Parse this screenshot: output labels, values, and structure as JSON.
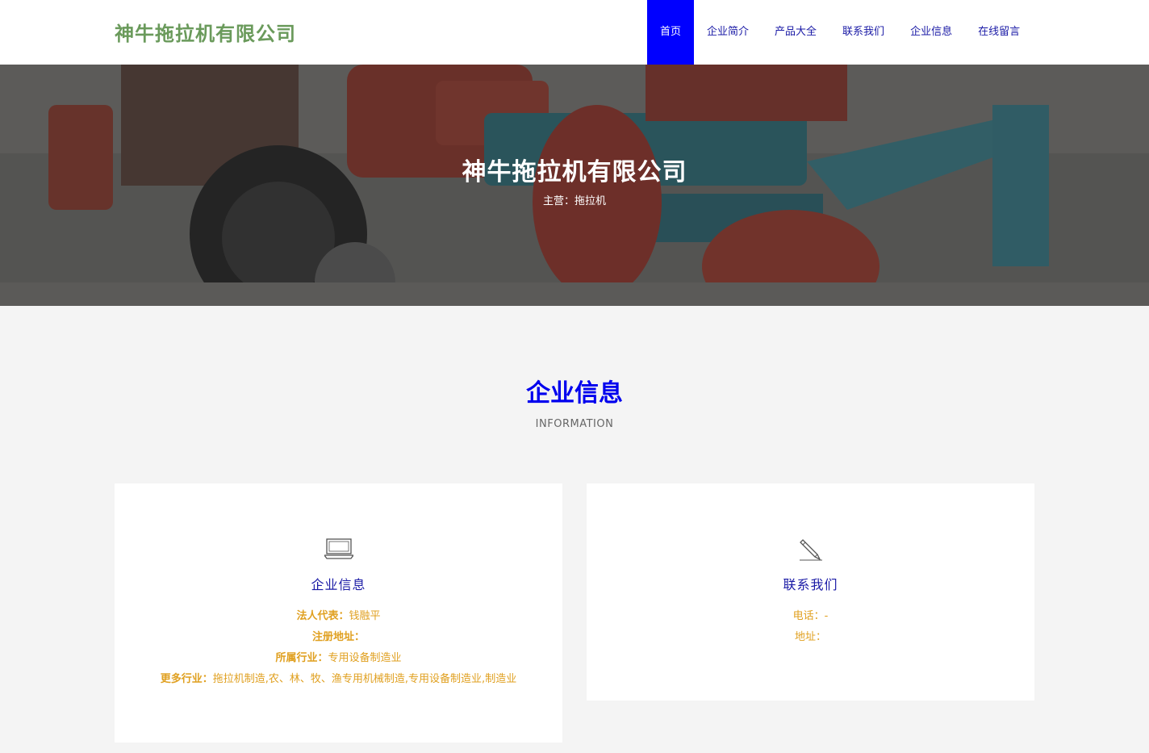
{
  "header": {
    "logo": "神牛拖拉机有限公司",
    "nav": [
      {
        "label": "首页",
        "active": true
      },
      {
        "label": "企业简介"
      },
      {
        "label": "产品大全"
      },
      {
        "label": "联系我们"
      },
      {
        "label": "企业信息"
      },
      {
        "label": "在线留言"
      }
    ],
    "active_color": "#0000ff"
  },
  "hero": {
    "title": "神牛拖拉机有限公司",
    "subtitle": "主营：拖拉机"
  },
  "section": {
    "title": "企业信息",
    "subtitle": "INFORMATION"
  },
  "cards": {
    "company": {
      "icon": "laptop-icon",
      "title": "企业信息",
      "lines": [
        {
          "label": "法人代表：",
          "value": "钱融平"
        },
        {
          "label": "注册地址：",
          "value": ""
        },
        {
          "label": "所属行业：",
          "value": "专用设备制造业"
        },
        {
          "label": "更多行业：",
          "value": "拖拉机制造,农、林、牧、渔专用机械制造,专用设备制造业,制造业"
        }
      ]
    },
    "contact": {
      "icon": "pencil-icon",
      "title": "联系我们",
      "lines": [
        {
          "label": "电话：",
          "value": "-"
        },
        {
          "label": "地址：",
          "value": ""
        }
      ]
    }
  },
  "colors": {
    "accent_blue": "#0000ee",
    "label_orange": "#e0a020",
    "logo_green": "#6a9a5b"
  }
}
